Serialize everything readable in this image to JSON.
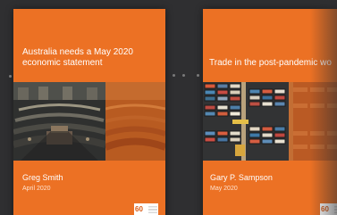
{
  "carousel": {
    "books": [
      {
        "title": "Australia needs a May 2020\neconomic statement",
        "author": "Greg Smith",
        "date": "April 2020",
        "badge": "60",
        "image": "parliament-chamber-image"
      },
      {
        "title": "Trade in the post-pandemic wo",
        "author": "Gary P. Sampson",
        "date": "May 2020",
        "badge": "60",
        "image": "shipping-containers-image"
      }
    ]
  },
  "colors": {
    "background": "#2f2f31",
    "cover_orange": "#ec7124",
    "accent": "#ffffff"
  }
}
